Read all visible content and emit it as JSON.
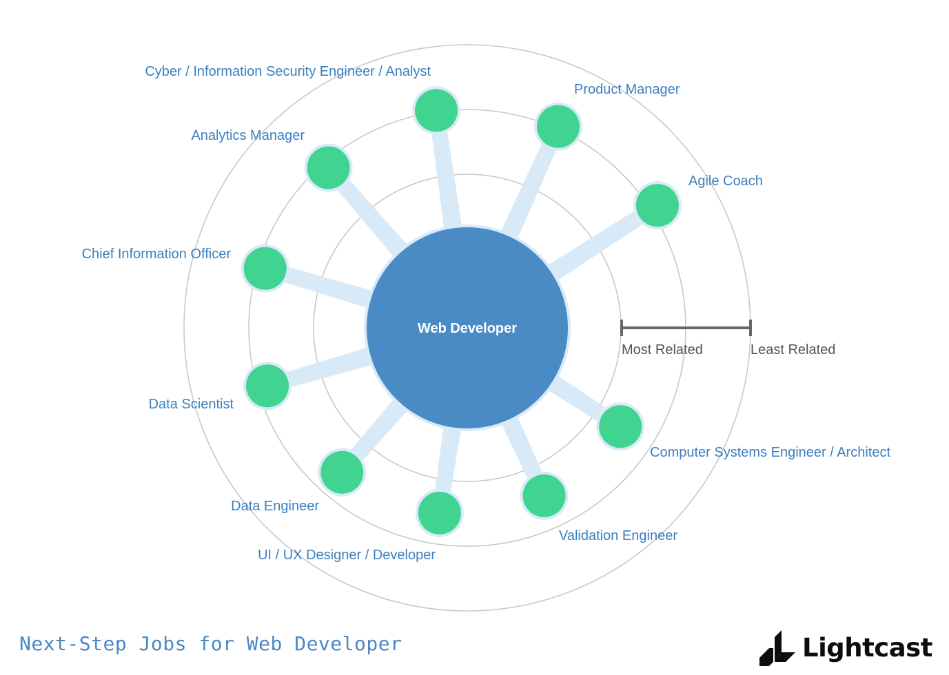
{
  "title": "Next-Step Jobs for Web Developer",
  "brand": {
    "name": "Lightcast",
    "icon": "lightcast-logo-icon"
  },
  "center_node": {
    "label": "Web Developer",
    "color": "#4a8bc6"
  },
  "legend": {
    "most_label": "Most Related",
    "least_label": "Least Related",
    "color": "#666666"
  },
  "colors": {
    "node_fill": "#40d490",
    "node_halo": "#d8e9f8",
    "link": "#d8e9f8",
    "label": "#3a7fc0",
    "ring": "#c8c8c8"
  },
  "rings": {
    "count": 3,
    "most_related_ring": 1,
    "least_related_ring": 3
  },
  "nodes": [
    {
      "label": "Cyber / Information Security Engineer / Analyst",
      "angle_deg": -98.1,
      "relatedness_distance": 0.51
    },
    {
      "label": "Product Manager",
      "angle_deg": -65.7,
      "relatedness_distance": 0.52
    },
    {
      "label": "Agile Coach",
      "angle_deg": -32.8,
      "relatedness_distance": 0.56
    },
    {
      "label": "Analytics Manager",
      "angle_deg": -130.9,
      "relatedness_distance": 0.45
    },
    {
      "label": "Chief Information Officer",
      "angle_deg": -163.6,
      "relatedness_distance": 0.44
    },
    {
      "label": "Data Scientist",
      "angle_deg": 163.8,
      "relatedness_distance": 0.42
    },
    {
      "label": "Data Engineer",
      "angle_deg": 130.9,
      "relatedness_distance": 0.29
    },
    {
      "label": "UI / UX Designer / Developer",
      "angle_deg": 98.5,
      "relatedness_distance": 0.26
    },
    {
      "label": "Validation Engineer",
      "angle_deg": 65.4,
      "relatedness_distance": 0.24
    },
    {
      "label": "Computer Systems Engineer / Architect",
      "angle_deg": 32.8,
      "relatedness_distance": 0.22
    }
  ]
}
